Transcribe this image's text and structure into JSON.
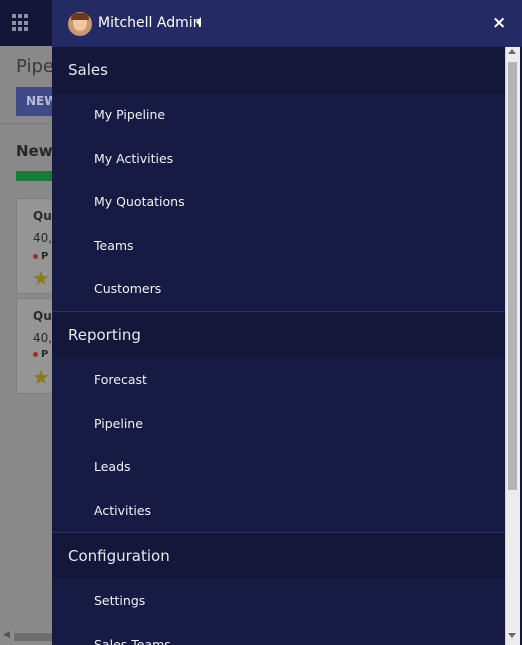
{
  "background": {
    "page_title": "Pipe",
    "new_button_label": "NEW",
    "column_title": "New",
    "cards": [
      {
        "title": "Qu",
        "amount": "40,",
        "tag": "P",
        "star": "★"
      },
      {
        "title": "Qu",
        "amount": "40,",
        "tag": "P",
        "star": "★"
      }
    ]
  },
  "menu": {
    "user": {
      "name": "Mitchell Admin"
    },
    "close_label": "×",
    "sections": [
      {
        "title": "Sales",
        "items": [
          "My Pipeline",
          "My Activities",
          "My Quotations",
          "Teams",
          "Customers"
        ]
      },
      {
        "title": "Reporting",
        "items": [
          "Forecast",
          "Pipeline",
          "Leads",
          "Activities"
        ]
      },
      {
        "title": "Configuration",
        "items": [
          "Settings",
          "Sales Teams"
        ]
      }
    ]
  },
  "colors": {
    "menu_bg": "#14163a",
    "menu_header_bg": "#242a63",
    "menu_text": "#f2f3f8"
  }
}
